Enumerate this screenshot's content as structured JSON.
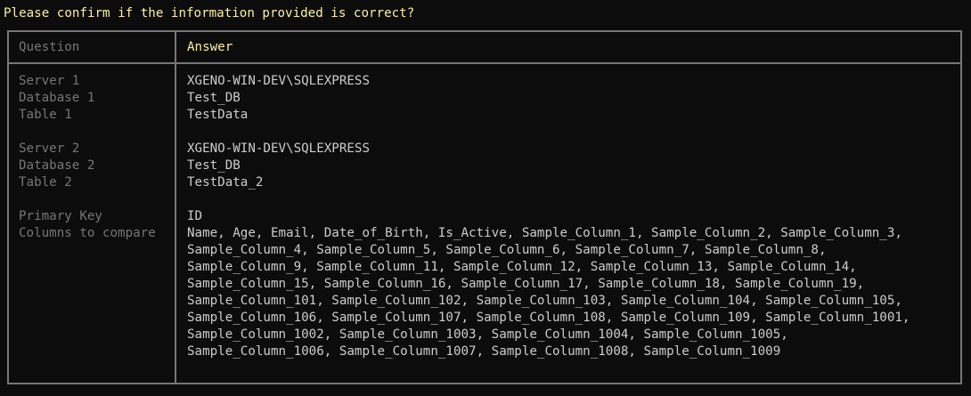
{
  "prompt": "Please confirm if the information provided is correct?",
  "table": {
    "header_question": "Question",
    "header_answer": "Answer",
    "server1": {
      "label": "Server 1",
      "value": "XGENO-WIN-DEV\\SQLEXPRESS"
    },
    "database1": {
      "label": "Database 1",
      "value": "Test_DB"
    },
    "table1": {
      "label": "Table 1",
      "value": "TestData"
    },
    "server2": {
      "label": "Server 2",
      "value": "XGENO-WIN-DEV\\SQLEXPRESS"
    },
    "database2": {
      "label": "Database 2",
      "value": "Test_DB"
    },
    "table2": {
      "label": "Table 2",
      "value": "TestData_2"
    },
    "primary_key": {
      "label": "Primary Key",
      "value": "ID"
    },
    "columns": {
      "label": "Columns to compare",
      "lines": [
        "Name, Age, Email, Date_of_Birth, Is_Active, Sample_Column_1, Sample_Column_2, Sample_Column_3,",
        "Sample_Column_4, Sample_Column_5, Sample_Column_6, Sample_Column_7, Sample_Column_8,",
        "Sample_Column_9, Sample_Column_11, Sample_Column_12, Sample_Column_13, Sample_Column_14,",
        "Sample_Column_15, Sample_Column_16, Sample_Column_17, Sample_Column_18, Sample_Column_19,",
        "Sample_Column_101, Sample_Column_102, Sample_Column_103, Sample_Column_104, Sample_Column_105,",
        "Sample_Column_106, Sample_Column_107, Sample_Column_108, Sample_Column_109, Sample_Column_1001,",
        "Sample_Column_1002, Sample_Column_1003, Sample_Column_1004, Sample_Column_1005,",
        "Sample_Column_1006, Sample_Column_1007, Sample_Column_1008, Sample_Column_1009"
      ]
    }
  }
}
